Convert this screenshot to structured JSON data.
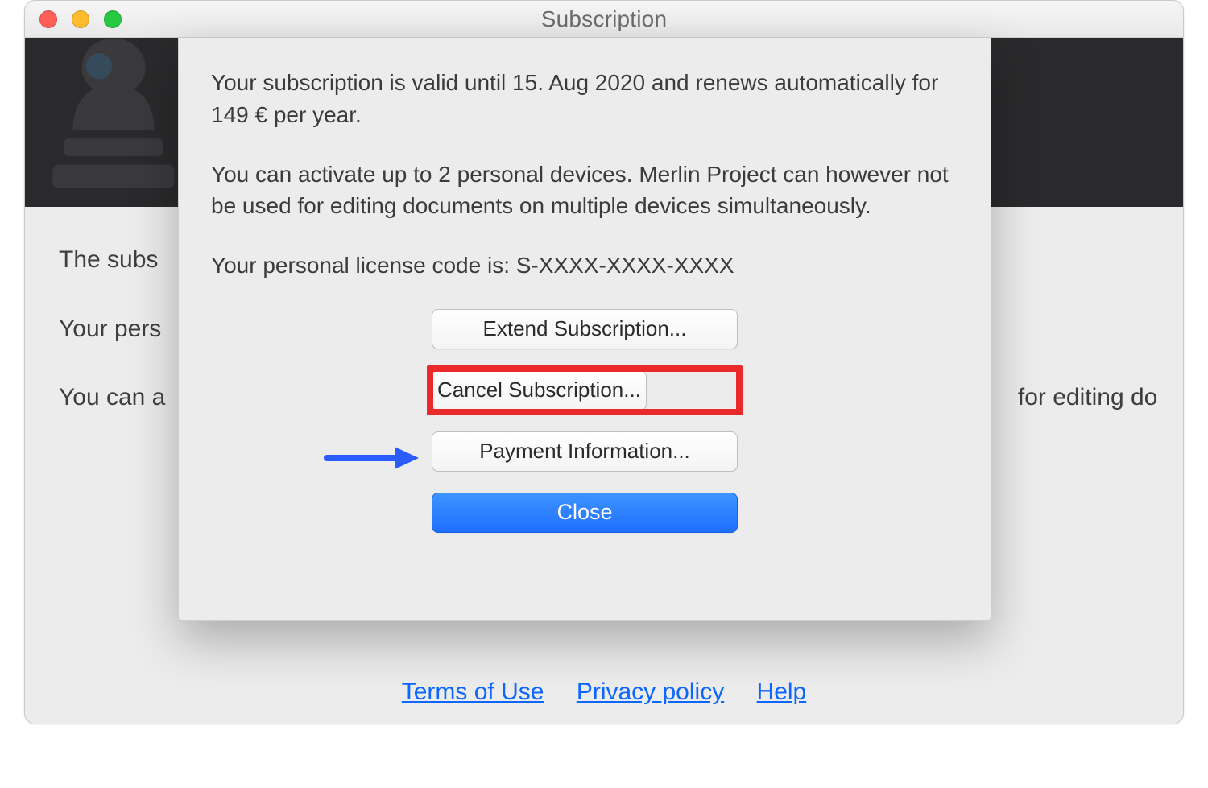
{
  "titlebar": {
    "title": "Subscription"
  },
  "sheet": {
    "para1": "Your subscription is valid until 15. Aug 2020 and renews automatically for 149 € per year.",
    "para2": "You can activate up to 2 personal devices. Merlin Project can however not be used for editing documents on multiple devices simultaneously.",
    "para3": "Your personal license code is: S-XXXX-XXXX-XXXX",
    "buttons": {
      "extend": "Extend Subscription...",
      "cancel": "Cancel Subscription...",
      "payment": "Payment Information...",
      "close": "Close"
    }
  },
  "base": {
    "line1": "The subs",
    "line2": "Your pers",
    "line3": "You can a                                                                                                                               for editing do"
  },
  "footer": {
    "terms": "Terms of Use",
    "privacy": "Privacy policy",
    "help": "Help"
  },
  "annotation": {
    "arrow_target": "cancel-subscription-button",
    "highlight_color": "#ea2a2a",
    "arrow_color": "#2a5cff"
  }
}
